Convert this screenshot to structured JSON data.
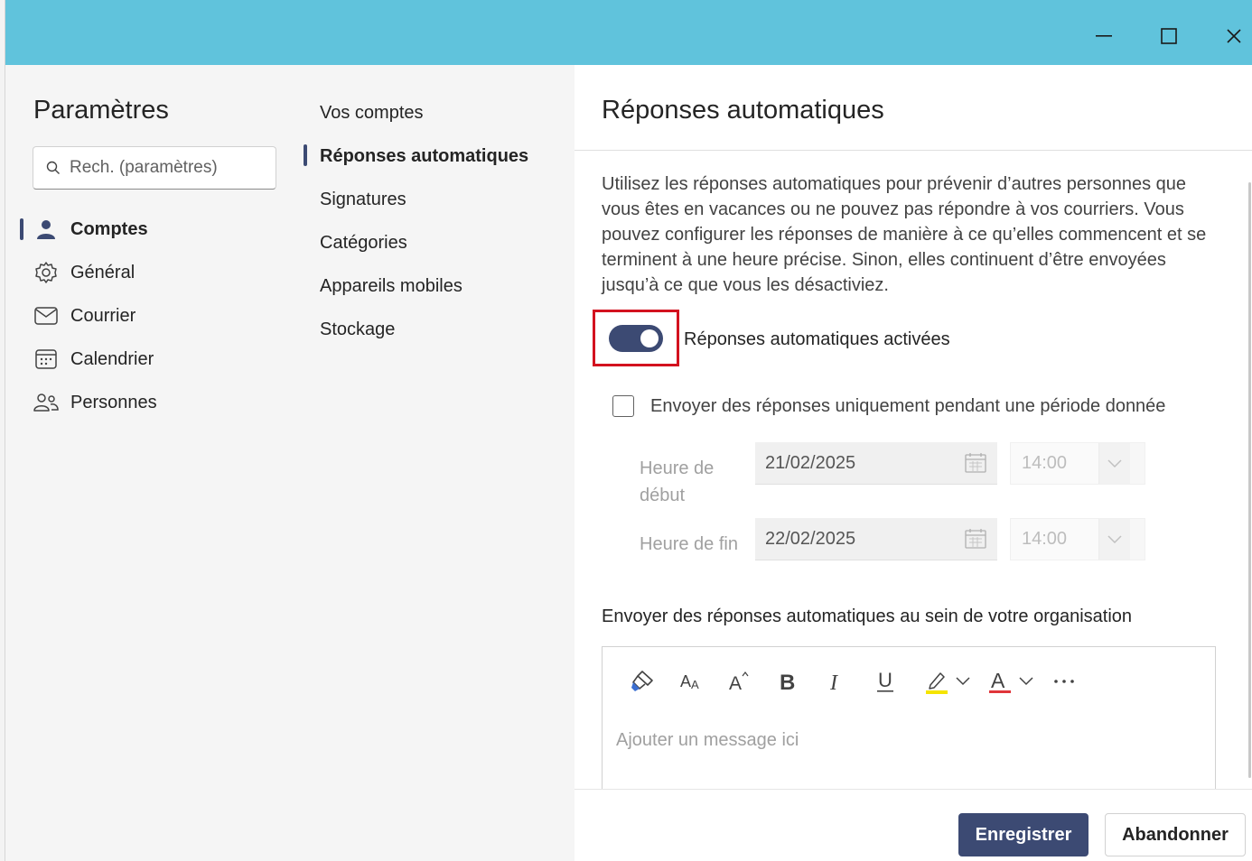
{
  "window": {
    "minimize_icon": "minimize-icon",
    "maximize_icon": "maximize-icon",
    "close_icon": "close-icon"
  },
  "settings_nav": {
    "title": "Paramètres",
    "search_placeholder": "Rech. (paramètres)",
    "items": [
      {
        "label": "Comptes",
        "icon": "person-icon",
        "active": true
      },
      {
        "label": "Général",
        "icon": "gear-icon"
      },
      {
        "label": "Courrier",
        "icon": "mail-icon"
      },
      {
        "label": "Calendrier",
        "icon": "calendar-icon"
      },
      {
        "label": "Personnes",
        "icon": "people-icon"
      }
    ]
  },
  "sub_nav": {
    "items": [
      {
        "label": "Vos comptes"
      },
      {
        "label": "Réponses automatiques",
        "active": true
      },
      {
        "label": "Signatures"
      },
      {
        "label": "Catégories"
      },
      {
        "label": "Appareils mobiles"
      },
      {
        "label": "Stockage"
      }
    ]
  },
  "content": {
    "title": "Réponses automatiques",
    "description": "Utilisez les réponses automatiques pour prévenir d’autres personnes que vous êtes en vacances ou ne pouvez pas répondre à vos courriers. Vous pouvez configurer les réponses de manière à ce qu’elles commencent et se terminent à une heure précise. Sinon, elles continuent d’être envoyées jusqu’à ce que vous les désactiviez.",
    "toggle_label": "Réponses automatiques activées",
    "toggle_on": true,
    "period_checkbox_label": "Envoyer des réponses uniquement pendant une période donnée",
    "period_checked": false,
    "start_label": "Heure de début",
    "start_date": "21/02/2025",
    "start_time": "14:00",
    "end_label": "Heure de fin",
    "end_date": "22/02/2025",
    "end_time": "14:00",
    "org_label": "Envoyer des réponses automatiques au sein de votre organisation",
    "message_placeholder": "Ajouter un message ici",
    "toolbar": [
      "format-painter-icon",
      "font-size-icon",
      "increase-font-icon",
      "bold-icon",
      "italic-icon",
      "underline-icon",
      "highlight-icon",
      "font-color-icon",
      "more-icon"
    ]
  },
  "footer": {
    "save_label": "Enregistrer",
    "discard_label": "Abandonner"
  },
  "colors": {
    "titlebar": "#60c3dc",
    "accent": "#3c4a73",
    "highlight_box": "#d3121f"
  }
}
